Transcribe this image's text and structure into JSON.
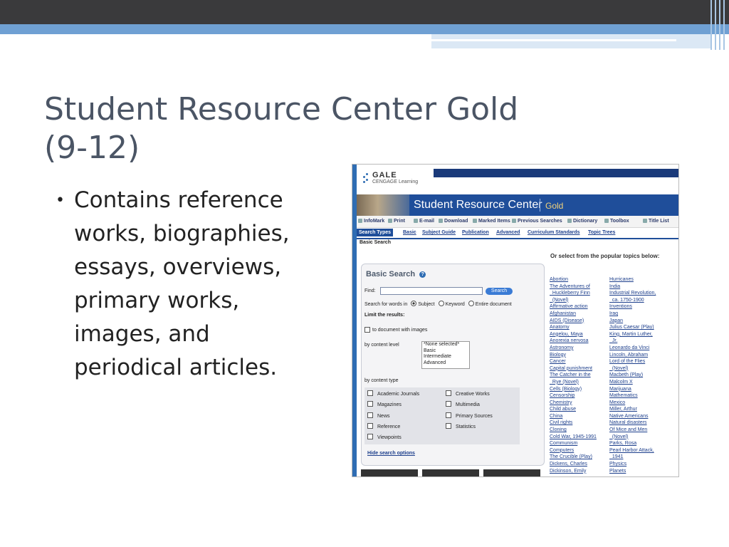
{
  "slide": {
    "title_line1": "Student Resource Center Gold",
    "title_line2": "(9-12)",
    "bullet_text": "Contains reference works, biographies, essays, overviews, primary works, images, and periodical articles."
  },
  "screenshot": {
    "logo_name": "GALE",
    "logo_sub": "CENGAGE Learning",
    "banner_title": "Student Resource Center",
    "banner_edition": "Gold",
    "toolbar": [
      "InfoMark",
      "Print",
      "E-mail",
      "Download",
      "Marked Items",
      "Previous Searches",
      "Dictionary",
      "Toolbox",
      "Title List"
    ],
    "search_tabs": [
      "Search Types",
      "Basic",
      "Subject Guide",
      "Publication",
      "Advanced",
      "Curriculum Standards",
      "Topic Trees"
    ],
    "sub_tab": "Basic Search",
    "panel_title": "Basic Search",
    "help_glyph": "?",
    "find_label": "Find:",
    "search_button": "Search",
    "search_in_label": "Search for words in",
    "radio_options": [
      "Subject",
      "Keyword",
      "Entire document"
    ],
    "limit_label": "Limit the results:",
    "images_option": "to document with images",
    "content_level_label": "by content level",
    "content_levels": [
      "*None selected*",
      "Basic",
      "Intermediate",
      "Advanced"
    ],
    "content_type_label": "by content type",
    "content_types_left": [
      "Academic Journals",
      "Magazines",
      "News",
      "Reference",
      "Viewpoints"
    ],
    "content_types_right": [
      "Creative Works",
      "Multimedia",
      "Primary Sources",
      "Statistics"
    ],
    "hide_link": "Hide search options",
    "topics_heading": "Or select from the popular topics below:",
    "topics_col1": [
      "Abortion",
      "The Adventures of",
      "  Huckleberry Finn",
      "  (Novel)",
      "Affirmative action",
      "Afghanistan",
      "AIDS (Disease)",
      "Anatomy",
      "Angelou, Maya",
      "Anorexia nervosa",
      "Astronomy",
      "Biology",
      "Cancer",
      "Capital punishment",
      "The Catcher in the",
      "  Rye (Novel)",
      "Cells (Biology)",
      "Censorship",
      "Chemistry",
      "Child abuse",
      "China",
      "Civil rights",
      "Cloning",
      "Cold War, 1945-1991",
      "Communism",
      "Computers",
      "The Crucible (Play)",
      "Dickens, Charles",
      "Dickinson, Emily"
    ],
    "topics_col2": [
      "Hurricanes",
      "India",
      "Industrial Revolution,",
      "  ca. 1750-1900",
      "Inventions",
      "Iraq",
      "Japan",
      "Julius Caesar (Play)",
      "King, Martin Luther,",
      "  Jr.",
      "Leonardo da Vinci",
      "Lincoln, Abraham",
      "Lord of the Flies",
      "  (Novel)",
      "Macbeth (Play)",
      "Malcolm X",
      "Marijuana",
      "Mathematics",
      "Mexico",
      "Miller, Arthur",
      "Native Americans",
      "Natural disasters",
      "Of Mice and Men",
      "  (Novel)",
      "Parks, Rosa",
      "Pearl Harbor Attack,",
      "  1941",
      "Physics",
      "Planets"
    ]
  }
}
